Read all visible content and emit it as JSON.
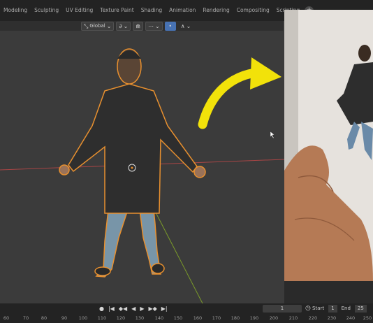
{
  "topbar": {
    "tabs": [
      "Modeling",
      "Sculpting",
      "UV Editing",
      "Texture Paint",
      "Shading",
      "Animation",
      "Rendering",
      "Compositing",
      "Scripting"
    ],
    "add_tab_label": "+"
  },
  "viewport_header": {
    "transform_orientation": "Global"
  },
  "colors": {
    "selection_outline": "#e8902f",
    "arrow": "#f2e20a",
    "x_axis": "#a84545",
    "y_axis": "#7a9a2a",
    "panel_bg": "#232323",
    "viewport_bg": "#3b3b3b"
  },
  "icons": [
    "pivot-icon",
    "orientation-icon",
    "snap-icon",
    "proportional-icon",
    "record-icon",
    "jump-start-icon",
    "prev-keyframe-icon",
    "play-reverse-icon",
    "play-icon",
    "next-keyframe-icon",
    "jump-end-icon",
    "clock-icon"
  ],
  "timeline": {
    "current_frame": "1",
    "start_label": "Start",
    "start_value": "1",
    "end_label": "End",
    "end_value": "25",
    "ruler_ticks": [
      "60",
      "70",
      "80",
      "90",
      "100",
      "110",
      "120",
      "130",
      "140",
      "150",
      "160",
      "170",
      "180",
      "190",
      "200",
      "210",
      "220",
      "230",
      "240",
      "250"
    ]
  }
}
